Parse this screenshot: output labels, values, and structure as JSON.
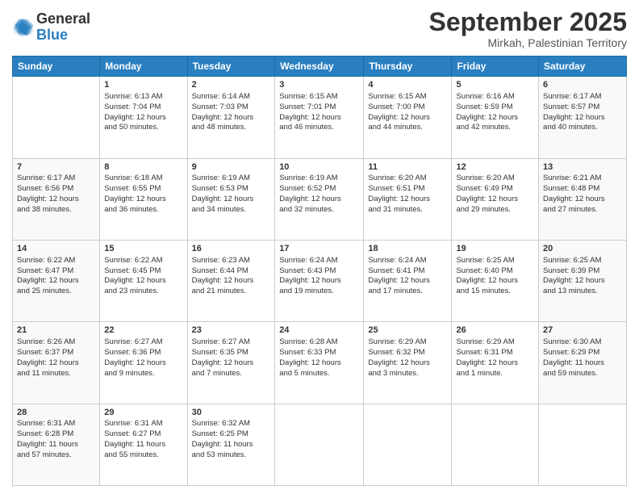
{
  "logo": {
    "general": "General",
    "blue": "Blue"
  },
  "title": "September 2025",
  "location": "Mirkah, Palestinian Territory",
  "days_header": [
    "Sunday",
    "Monday",
    "Tuesday",
    "Wednesday",
    "Thursday",
    "Friday",
    "Saturday"
  ],
  "weeks": [
    [
      {
        "day": "",
        "content": ""
      },
      {
        "day": "1",
        "content": "Sunrise: 6:13 AM\nSunset: 7:04 PM\nDaylight: 12 hours\nand 50 minutes."
      },
      {
        "day": "2",
        "content": "Sunrise: 6:14 AM\nSunset: 7:03 PM\nDaylight: 12 hours\nand 48 minutes."
      },
      {
        "day": "3",
        "content": "Sunrise: 6:15 AM\nSunset: 7:01 PM\nDaylight: 12 hours\nand 46 minutes."
      },
      {
        "day": "4",
        "content": "Sunrise: 6:15 AM\nSunset: 7:00 PM\nDaylight: 12 hours\nand 44 minutes."
      },
      {
        "day": "5",
        "content": "Sunrise: 6:16 AM\nSunset: 6:59 PM\nDaylight: 12 hours\nand 42 minutes."
      },
      {
        "day": "6",
        "content": "Sunrise: 6:17 AM\nSunset: 6:57 PM\nDaylight: 12 hours\nand 40 minutes."
      }
    ],
    [
      {
        "day": "7",
        "content": "Sunrise: 6:17 AM\nSunset: 6:56 PM\nDaylight: 12 hours\nand 38 minutes."
      },
      {
        "day": "8",
        "content": "Sunrise: 6:18 AM\nSunset: 6:55 PM\nDaylight: 12 hours\nand 36 minutes."
      },
      {
        "day": "9",
        "content": "Sunrise: 6:19 AM\nSunset: 6:53 PM\nDaylight: 12 hours\nand 34 minutes."
      },
      {
        "day": "10",
        "content": "Sunrise: 6:19 AM\nSunset: 6:52 PM\nDaylight: 12 hours\nand 32 minutes."
      },
      {
        "day": "11",
        "content": "Sunrise: 6:20 AM\nSunset: 6:51 PM\nDaylight: 12 hours\nand 31 minutes."
      },
      {
        "day": "12",
        "content": "Sunrise: 6:20 AM\nSunset: 6:49 PM\nDaylight: 12 hours\nand 29 minutes."
      },
      {
        "day": "13",
        "content": "Sunrise: 6:21 AM\nSunset: 6:48 PM\nDaylight: 12 hours\nand 27 minutes."
      }
    ],
    [
      {
        "day": "14",
        "content": "Sunrise: 6:22 AM\nSunset: 6:47 PM\nDaylight: 12 hours\nand 25 minutes."
      },
      {
        "day": "15",
        "content": "Sunrise: 6:22 AM\nSunset: 6:45 PM\nDaylight: 12 hours\nand 23 minutes."
      },
      {
        "day": "16",
        "content": "Sunrise: 6:23 AM\nSunset: 6:44 PM\nDaylight: 12 hours\nand 21 minutes."
      },
      {
        "day": "17",
        "content": "Sunrise: 6:24 AM\nSunset: 6:43 PM\nDaylight: 12 hours\nand 19 minutes."
      },
      {
        "day": "18",
        "content": "Sunrise: 6:24 AM\nSunset: 6:41 PM\nDaylight: 12 hours\nand 17 minutes."
      },
      {
        "day": "19",
        "content": "Sunrise: 6:25 AM\nSunset: 6:40 PM\nDaylight: 12 hours\nand 15 minutes."
      },
      {
        "day": "20",
        "content": "Sunrise: 6:25 AM\nSunset: 6:39 PM\nDaylight: 12 hours\nand 13 minutes."
      }
    ],
    [
      {
        "day": "21",
        "content": "Sunrise: 6:26 AM\nSunset: 6:37 PM\nDaylight: 12 hours\nand 11 minutes."
      },
      {
        "day": "22",
        "content": "Sunrise: 6:27 AM\nSunset: 6:36 PM\nDaylight: 12 hours\nand 9 minutes."
      },
      {
        "day": "23",
        "content": "Sunrise: 6:27 AM\nSunset: 6:35 PM\nDaylight: 12 hours\nand 7 minutes."
      },
      {
        "day": "24",
        "content": "Sunrise: 6:28 AM\nSunset: 6:33 PM\nDaylight: 12 hours\nand 5 minutes."
      },
      {
        "day": "25",
        "content": "Sunrise: 6:29 AM\nSunset: 6:32 PM\nDaylight: 12 hours\nand 3 minutes."
      },
      {
        "day": "26",
        "content": "Sunrise: 6:29 AM\nSunset: 6:31 PM\nDaylight: 12 hours\nand 1 minute."
      },
      {
        "day": "27",
        "content": "Sunrise: 6:30 AM\nSunset: 6:29 PM\nDaylight: 11 hours\nand 59 minutes."
      }
    ],
    [
      {
        "day": "28",
        "content": "Sunrise: 6:31 AM\nSunset: 6:28 PM\nDaylight: 11 hours\nand 57 minutes."
      },
      {
        "day": "29",
        "content": "Sunrise: 6:31 AM\nSunset: 6:27 PM\nDaylight: 11 hours\nand 55 minutes."
      },
      {
        "day": "30",
        "content": "Sunrise: 6:32 AM\nSunset: 6:25 PM\nDaylight: 11 hours\nand 53 minutes."
      },
      {
        "day": "",
        "content": ""
      },
      {
        "day": "",
        "content": ""
      },
      {
        "day": "",
        "content": ""
      },
      {
        "day": "",
        "content": ""
      }
    ]
  ]
}
